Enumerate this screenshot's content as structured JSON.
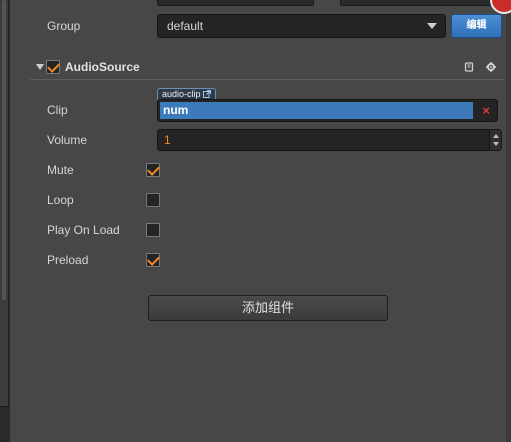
{
  "group": {
    "label": "Group",
    "value": "default",
    "edit_label": "编辑"
  },
  "component": {
    "title": "AudioSource",
    "enabled": true,
    "icons": [
      "book-icon",
      "gear-icon"
    ]
  },
  "props": {
    "clip": {
      "label": "Clip",
      "type_tag": "audio-clip",
      "value": "num",
      "clear": "×"
    },
    "volume": {
      "label": "Volume",
      "value": "1"
    },
    "mute": {
      "label": "Mute",
      "checked": true
    },
    "loop": {
      "label": "Loop",
      "checked": false
    },
    "play_on_load": {
      "label": "Play On Load",
      "checked": false
    },
    "preload": {
      "label": "Preload",
      "checked": true
    }
  },
  "add_component_label": "添加组件",
  "colors": {
    "panel": "#474747",
    "accent_orange": "#f08a24",
    "selection_blue": "#3d7ab9",
    "button_blue": "#3a7cc6",
    "clear_red": "#e03a3a"
  }
}
